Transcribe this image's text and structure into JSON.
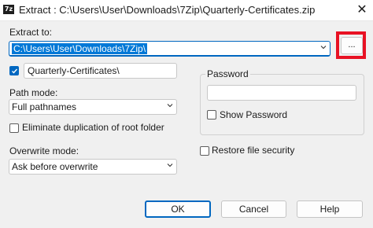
{
  "window": {
    "title": "Extract : C:\\Users\\User\\Downloads\\7Zip\\Quarterly-Certificates.zip",
    "app_icon_text": "7z",
    "close_glyph": "✕"
  },
  "extract_to": {
    "label": "Extract to:",
    "value": "C:\\Users\\User\\Downloads\\7Zip\\",
    "browse_label": "...",
    "subfolder_checked": true,
    "subfolder_value": "Quarterly-Certificates\\"
  },
  "path_mode": {
    "label": "Path mode:",
    "value": "Full pathnames"
  },
  "eliminate_duplication": {
    "label": "Eliminate duplication of root folder",
    "checked": false
  },
  "overwrite_mode": {
    "label": "Overwrite mode:",
    "value": "Ask before overwrite"
  },
  "password": {
    "label": "Password",
    "value": "",
    "show_password_label": "Show Password",
    "show_password_checked": false
  },
  "restore_security": {
    "label": "Restore file security",
    "checked": false
  },
  "buttons": {
    "ok": "OK",
    "cancel": "Cancel",
    "help": "Help"
  },
  "colors": {
    "accent": "#0067c0",
    "highlight_frame": "#e81123",
    "selection": "#0078d7"
  }
}
